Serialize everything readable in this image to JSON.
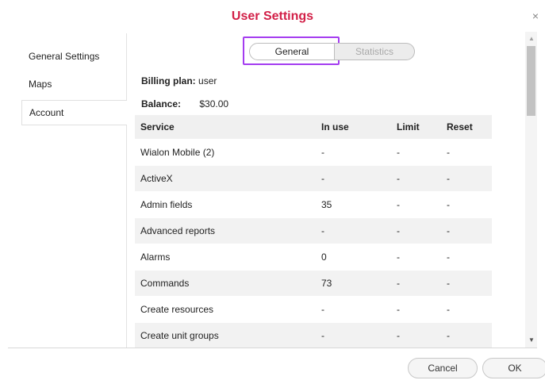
{
  "dialog": {
    "title": "User Settings",
    "close_glyph": "×"
  },
  "sidebar": {
    "items": [
      {
        "label": "General Settings"
      },
      {
        "label": "Maps"
      },
      {
        "label": "Account"
      }
    ],
    "selected": "Account"
  },
  "tabs": {
    "general": "General",
    "statistics": "Statistics",
    "active": "General"
  },
  "account": {
    "billing_label": "Billing plan:",
    "billing_value": "user",
    "balance_label": "Balance:",
    "balance_value": "$30.00"
  },
  "table": {
    "headers": [
      "Service",
      "In use",
      "Limit",
      "Reset"
    ],
    "rows": [
      [
        "Wialon Mobile (2)",
        "-",
        "-",
        "-"
      ],
      [
        "ActiveX",
        "-",
        "-",
        "-"
      ],
      [
        "Admin fields",
        "35",
        "-",
        "-"
      ],
      [
        "Advanced reports",
        "-",
        "-",
        "-"
      ],
      [
        "Alarms",
        "0",
        "-",
        "-"
      ],
      [
        "Commands",
        "73",
        "-",
        "-"
      ],
      [
        "Create resources",
        "-",
        "-",
        "-"
      ],
      [
        "Create unit groups",
        "-",
        "-",
        "-"
      ]
    ]
  },
  "footer": {
    "cancel": "Cancel",
    "ok": "OK"
  },
  "colors": {
    "title": "#d21f47",
    "highlight": "#a43cf0"
  }
}
